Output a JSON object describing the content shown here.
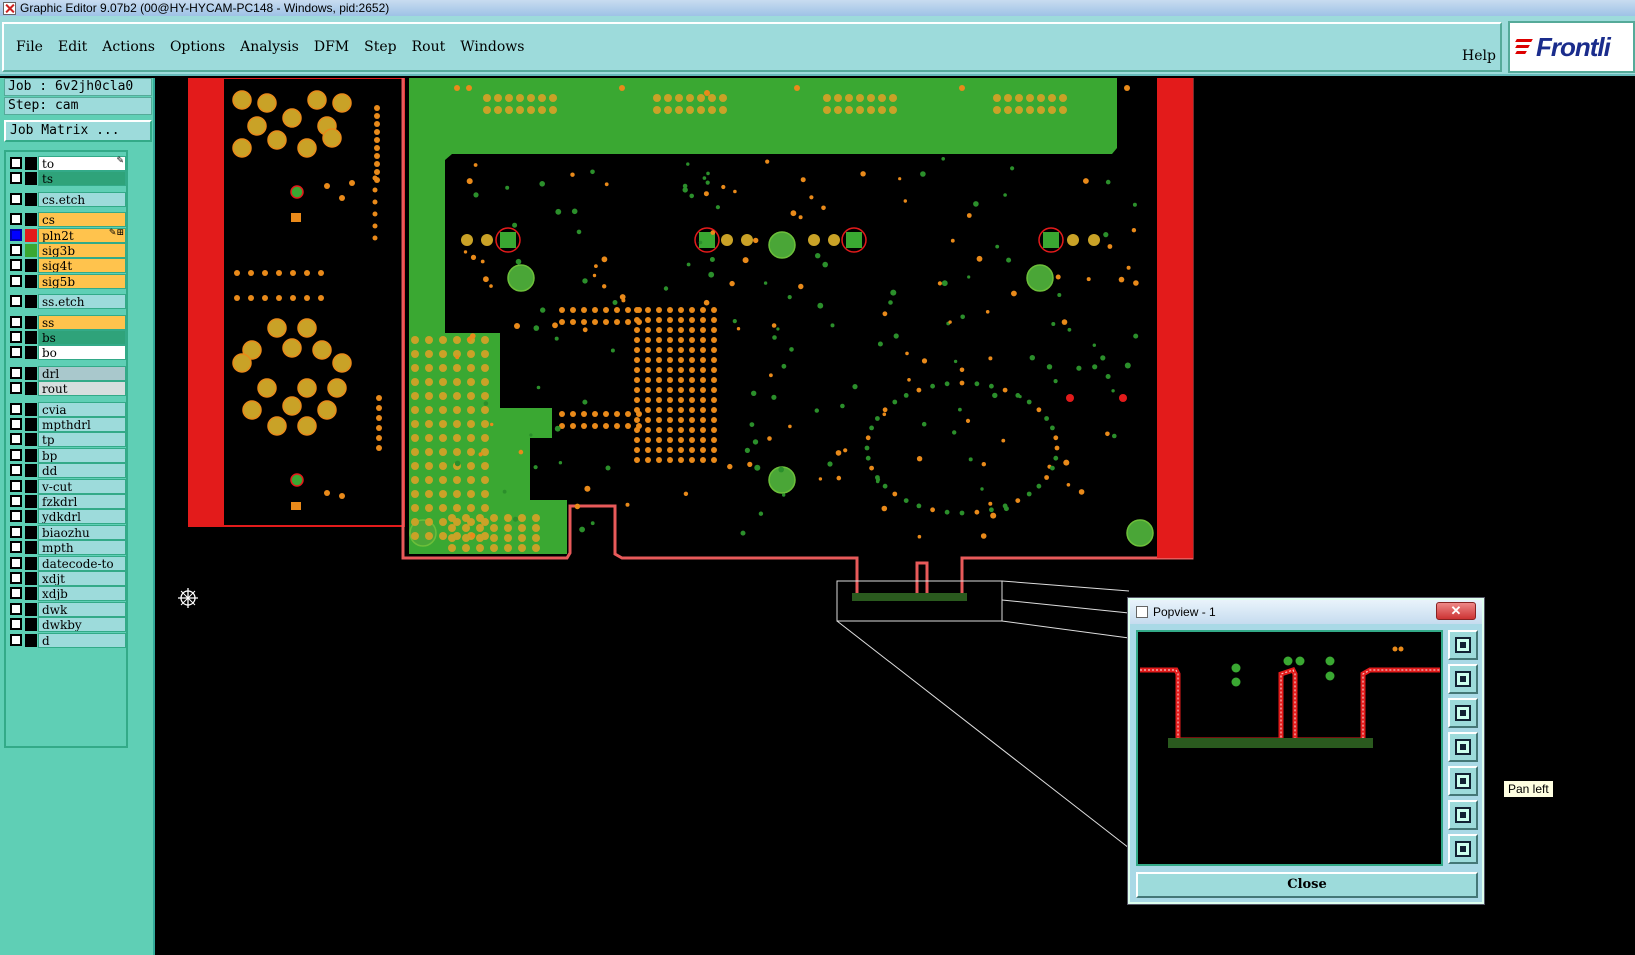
{
  "window": {
    "title": "Graphic Editor 9.07b2 (00@HY-HYCAM-PC148 - Windows, pid:2652)"
  },
  "menubar": {
    "items": [
      {
        "label": "File"
      },
      {
        "label": "Edit"
      },
      {
        "label": "Actions"
      },
      {
        "label": "Options"
      },
      {
        "label": "Analysis"
      },
      {
        "label": "DFM"
      },
      {
        "label": "Step"
      },
      {
        "label": "Rout"
      },
      {
        "label": "Windows"
      }
    ],
    "help": "Help",
    "brand": "Frontli"
  },
  "info": {
    "job": "Job : 6v2jh0cla0",
    "step": "Step: cam",
    "job_matrix": "Job Matrix ..."
  },
  "layers": [
    {
      "name": "to",
      "color": "#ffffff",
      "flags": "✎"
    },
    {
      "name": "ts",
      "color": "#2fa37a"
    },
    {
      "name": "cs.etch",
      "color": "#9ddbdb"
    },
    {
      "name": "cs",
      "color": "#ffc34d"
    },
    {
      "name": "pln2t",
      "color": "#ffc34d",
      "active": true,
      "swatch": "#e31b1b",
      "flags": "✎⊞"
    },
    {
      "name": "sig3b",
      "color": "#ffc34d",
      "swatch": "#3aa832"
    },
    {
      "name": "sig4t",
      "color": "#ffc34d"
    },
    {
      "name": "sig5b",
      "color": "#ffc34d"
    },
    {
      "name": "ss.etch",
      "color": "#9ddbdb"
    },
    {
      "name": "ss",
      "color": "#ffc34d"
    },
    {
      "name": "bs",
      "color": "#2fa37a"
    },
    {
      "name": "bo",
      "color": "#ffffff"
    },
    {
      "name": "drl",
      "color": "#a9c8cc"
    },
    {
      "name": "rout",
      "color": "#d6dede"
    },
    {
      "name": "cvia",
      "color": "#9ddbdb"
    },
    {
      "name": "mpthdrl",
      "color": "#9ddbdb"
    },
    {
      "name": "tp",
      "color": "#9ddbdb"
    },
    {
      "name": "bp",
      "color": "#9ddbdb"
    },
    {
      "name": "dd",
      "color": "#9ddbdb"
    },
    {
      "name": "v-cut",
      "color": "#9ddbdb"
    },
    {
      "name": "fzkdrl",
      "color": "#9ddbdb"
    },
    {
      "name": "ydkdrl",
      "color": "#9ddbdb"
    },
    {
      "name": "biaozhu",
      "color": "#9ddbdb"
    },
    {
      "name": "mpth",
      "color": "#9ddbdb"
    },
    {
      "name": "datecode-to",
      "color": "#9ddbdb"
    },
    {
      "name": "xdjt",
      "color": "#9ddbdb"
    },
    {
      "name": "xdjb",
      "color": "#9ddbdb"
    },
    {
      "name": "dwk",
      "color": "#9ddbdb"
    },
    {
      "name": "dwkby",
      "color": "#9ddbdb"
    },
    {
      "name": "d",
      "color": "#9ddbdb"
    }
  ],
  "popview": {
    "title": "Popview - 1",
    "close_x": "✕",
    "close_label": "Close",
    "tools": [
      {
        "name": "zoom-window"
      },
      {
        "name": "pan-up"
      },
      {
        "name": "pan-down"
      },
      {
        "name": "pan-right"
      },
      {
        "name": "pan-left"
      },
      {
        "name": "fit-all"
      },
      {
        "name": "zoom-home"
      }
    ]
  },
  "tooltip": {
    "text": "Pan left"
  },
  "colors": {
    "copper_green": "#3aa832",
    "pad_orange": "#c9a227",
    "outline_red": "#e31b1b",
    "panel_teal": "#5fcfb5",
    "menu_cyan": "#9ddbdb"
  }
}
